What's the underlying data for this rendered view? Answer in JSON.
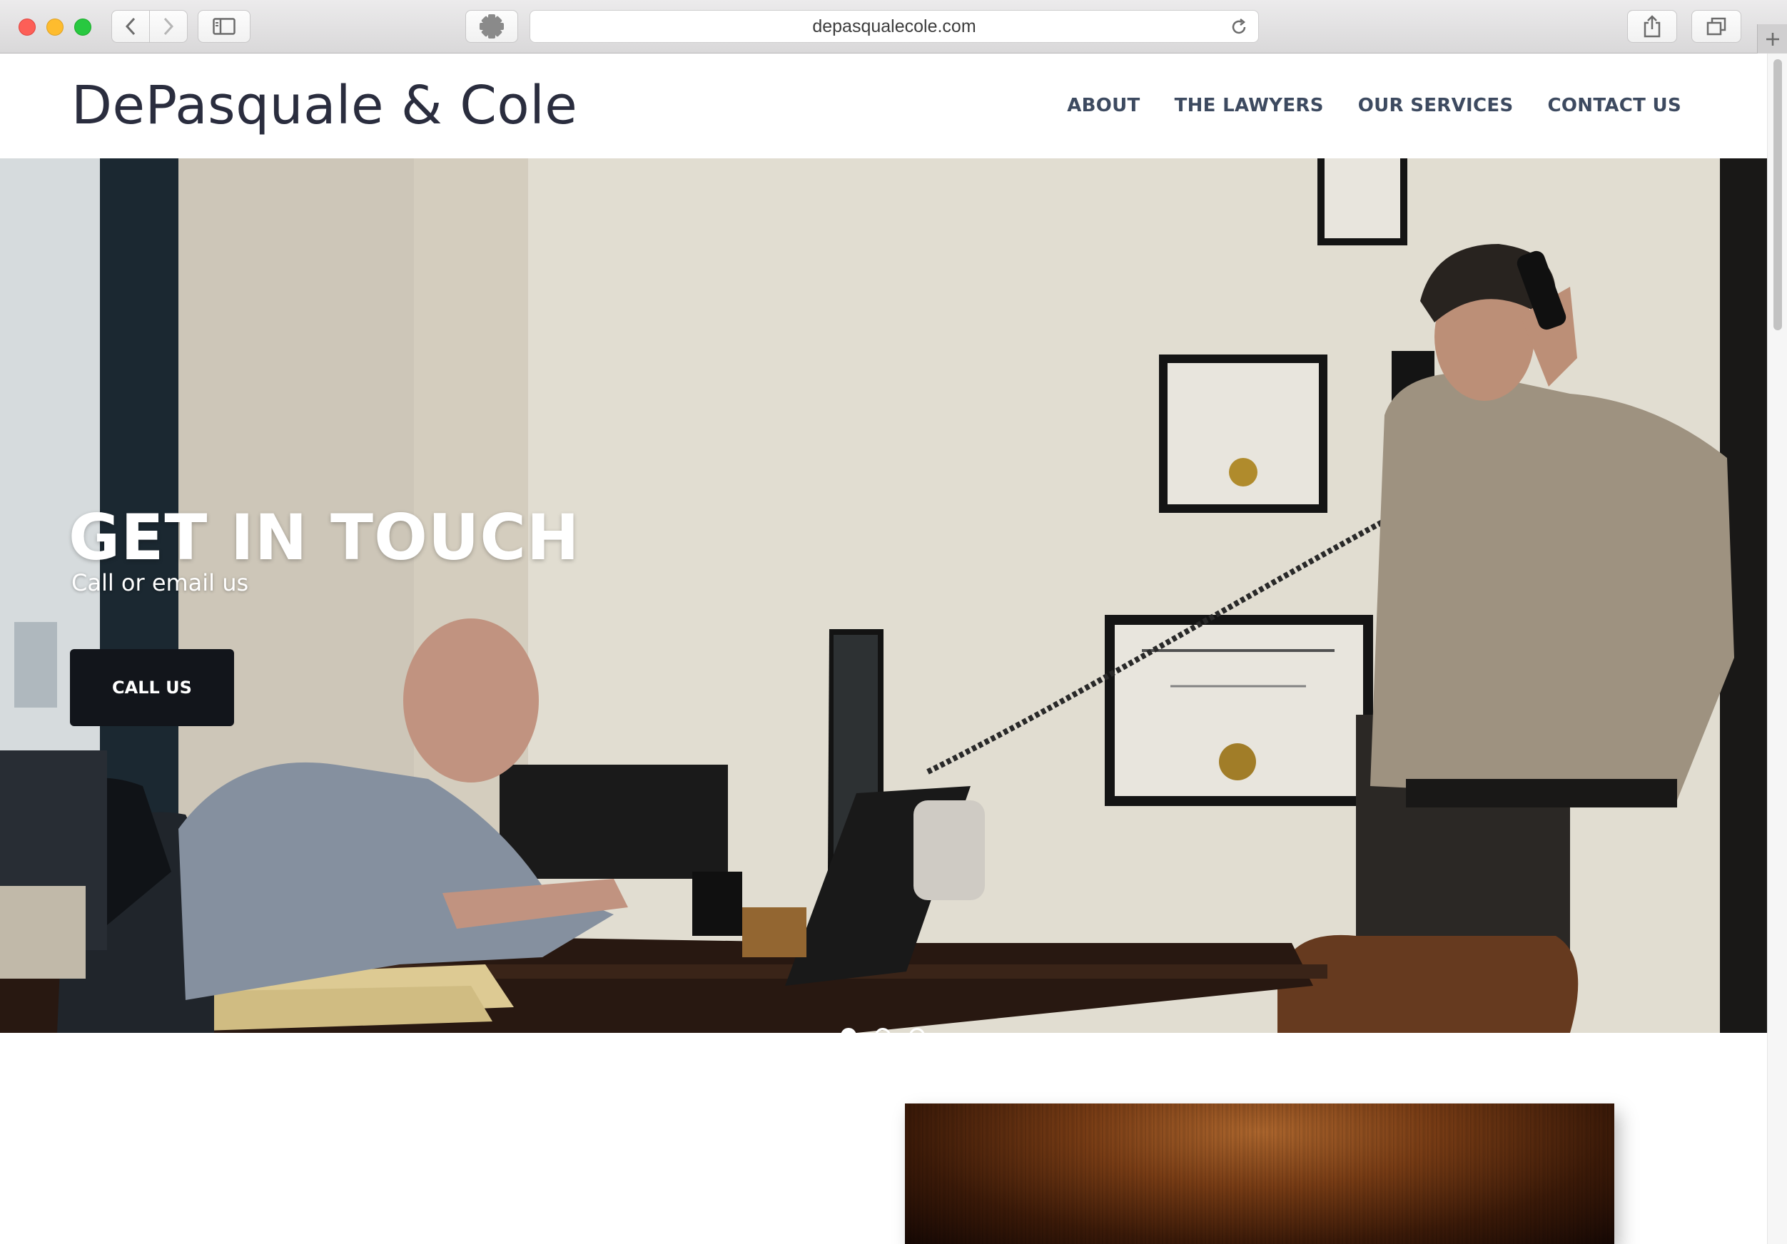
{
  "browser": {
    "url": "depasqualecole.com"
  },
  "site": {
    "brand": "DePasquale & Cole",
    "nav": [
      {
        "label": "ABOUT"
      },
      {
        "label": "THE LAWYERS"
      },
      {
        "label": "OUR SERVICES"
      },
      {
        "label": "CONTACT US"
      }
    ]
  },
  "hero": {
    "title": "GET IN TOUCH",
    "subtitle": "Call or email us",
    "cta_label": "CALL US",
    "slides": 3,
    "active_slide": 1
  },
  "colors": {
    "brand_text": "#2a2d3e",
    "nav_text": "#3d4a60",
    "cta_bg": "#12151b"
  }
}
